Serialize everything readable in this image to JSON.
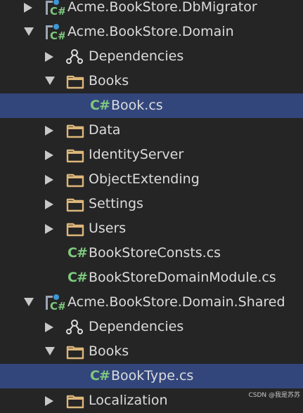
{
  "tree": {
    "rows": [
      {
        "label": "Acme.BookStore.DbMigrator",
        "icon": "csharp-project-icon",
        "expanded": false
      },
      {
        "label": "Acme.BookStore.Domain",
        "icon": "csharp-project-icon",
        "expanded": true
      },
      {
        "label": "Dependencies",
        "icon": "dependencies-icon",
        "expanded": false
      },
      {
        "label": "Books",
        "icon": "folder-icon",
        "expanded": true
      },
      {
        "label": "Book.cs",
        "icon": "csharp-file-icon",
        "selected": true
      },
      {
        "label": "Data",
        "icon": "folder-icon",
        "expanded": false
      },
      {
        "label": "IdentityServer",
        "icon": "folder-icon",
        "expanded": false
      },
      {
        "label": "ObjectExtending",
        "icon": "folder-icon",
        "expanded": false
      },
      {
        "label": "Settings",
        "icon": "folder-icon",
        "expanded": false
      },
      {
        "label": "Users",
        "icon": "folder-icon",
        "expanded": false
      },
      {
        "label": "BookStoreConsts.cs",
        "icon": "csharp-file-icon"
      },
      {
        "label": "BookStoreDomainModule.cs",
        "icon": "csharp-file-icon"
      },
      {
        "label": "Acme.BookStore.Domain.Shared",
        "icon": "csharp-project-icon",
        "expanded": true
      },
      {
        "label": "Dependencies",
        "icon": "dependencies-icon",
        "expanded": false
      },
      {
        "label": "Books",
        "icon": "folder-icon",
        "expanded": true
      },
      {
        "label": "BookType.cs",
        "icon": "csharp-file-icon",
        "selected": true
      },
      {
        "label": "Localization",
        "icon": "folder-icon",
        "expanded": false
      }
    ],
    "csharp_glyph": "C#"
  },
  "watermark": "CSDN @我是苏苏",
  "colors": {
    "background": "#252526",
    "selection": "#33467c",
    "folder": "#dcb67a",
    "csharp": "#7ec87e",
    "text": "#dcdcdc"
  }
}
